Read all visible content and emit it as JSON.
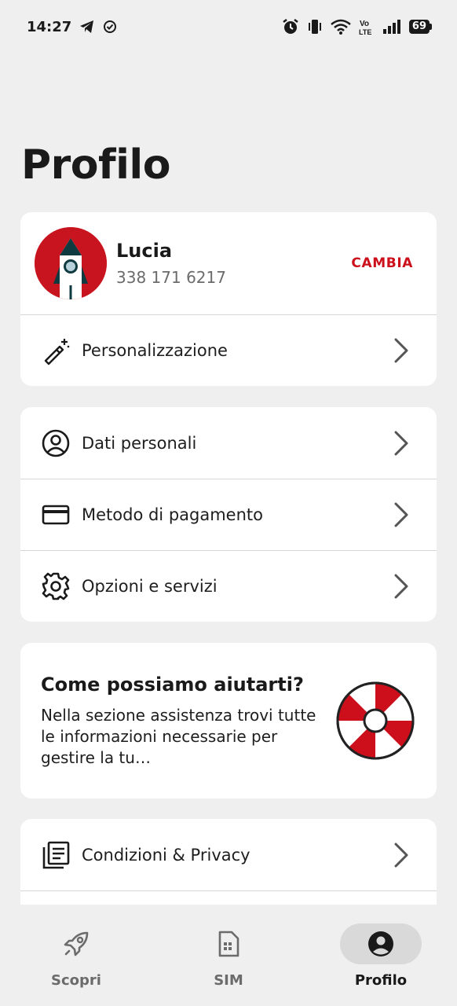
{
  "status_bar": {
    "time": "14:27",
    "battery": "69",
    "icons": [
      "telegram-icon",
      "check-circle-icon",
      "alarm-icon",
      "vibrate-icon",
      "wifi-icon",
      "volte-icon",
      "signal-icon",
      "battery-icon"
    ]
  },
  "page": {
    "title": "Profilo"
  },
  "profile": {
    "name": "Lucia",
    "phone": "338 171 6217",
    "change_label": "CAMBIA",
    "personalization_label": "Personalizzazione"
  },
  "account_menu": {
    "items": [
      {
        "label": "Dati personali",
        "icon": "user-circle-icon"
      },
      {
        "label": "Metodo di pagamento",
        "icon": "credit-card-icon"
      },
      {
        "label": "Opzioni e servizi",
        "icon": "gear-icon"
      }
    ]
  },
  "help_card": {
    "title": "Come possiamo aiutarti?",
    "body": "Nella sezione assistenza trovi tutte le informazioni necessarie per gestire la tu…",
    "icon": "lifebuoy-icon"
  },
  "legal_menu": {
    "items": [
      {
        "label": "Condizioni & Privacy",
        "icon": "document-icon"
      }
    ]
  },
  "bottom_nav": {
    "items": [
      {
        "label": "Scopri",
        "icon": "rocket-icon",
        "active": false
      },
      {
        "label": "SIM",
        "icon": "sim-card-icon",
        "active": false
      },
      {
        "label": "Profilo",
        "icon": "account-icon",
        "active": true
      }
    ]
  },
  "colors": {
    "accent": "#cc0f1a",
    "background": "#efefef",
    "card": "#ffffff"
  }
}
